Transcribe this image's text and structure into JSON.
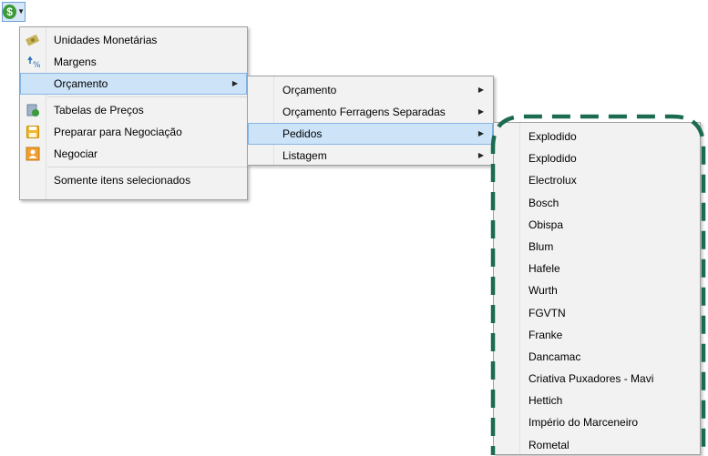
{
  "menu1": {
    "items": [
      {
        "label": "Unidades Monetárias",
        "icon": "money-icon"
      },
      {
        "label": "Margens",
        "icon": "percent-icon"
      },
      {
        "label": "Orçamento",
        "icon": "",
        "submenu": true,
        "selected": true
      },
      {
        "label": "Tabelas de Preços",
        "icon": "price-table-icon"
      },
      {
        "label": "Preparar para Negociação",
        "icon": "save-icon"
      },
      {
        "label": "Negociar",
        "icon": "negotiate-icon"
      },
      {
        "label": "Somente itens selecionados",
        "icon": ""
      }
    ]
  },
  "menu2": {
    "items": [
      {
        "label": "Orçamento"
      },
      {
        "label": "Orçamento Ferragens Separadas"
      },
      {
        "label": "Pedidos",
        "selected": true
      },
      {
        "label": "Listagem"
      }
    ]
  },
  "menu3": {
    "items": [
      "Explodido",
      "Explodido",
      "Electrolux",
      "Bosch",
      "Obispa",
      "Blum",
      "Hafele",
      "Wurth",
      "FGVTN",
      "Franke",
      "Dancamac",
      "Criativa Puxadores - Mavi",
      "Hettich",
      "Império do Marceneiro",
      "Rometal"
    ]
  },
  "toolbar": {
    "icon": "dollar-icon",
    "symbol": "$"
  },
  "colors": {
    "highlight": "#cce3f8",
    "dash": "#1b6a52",
    "menu_bg": "#f2f2f2"
  }
}
